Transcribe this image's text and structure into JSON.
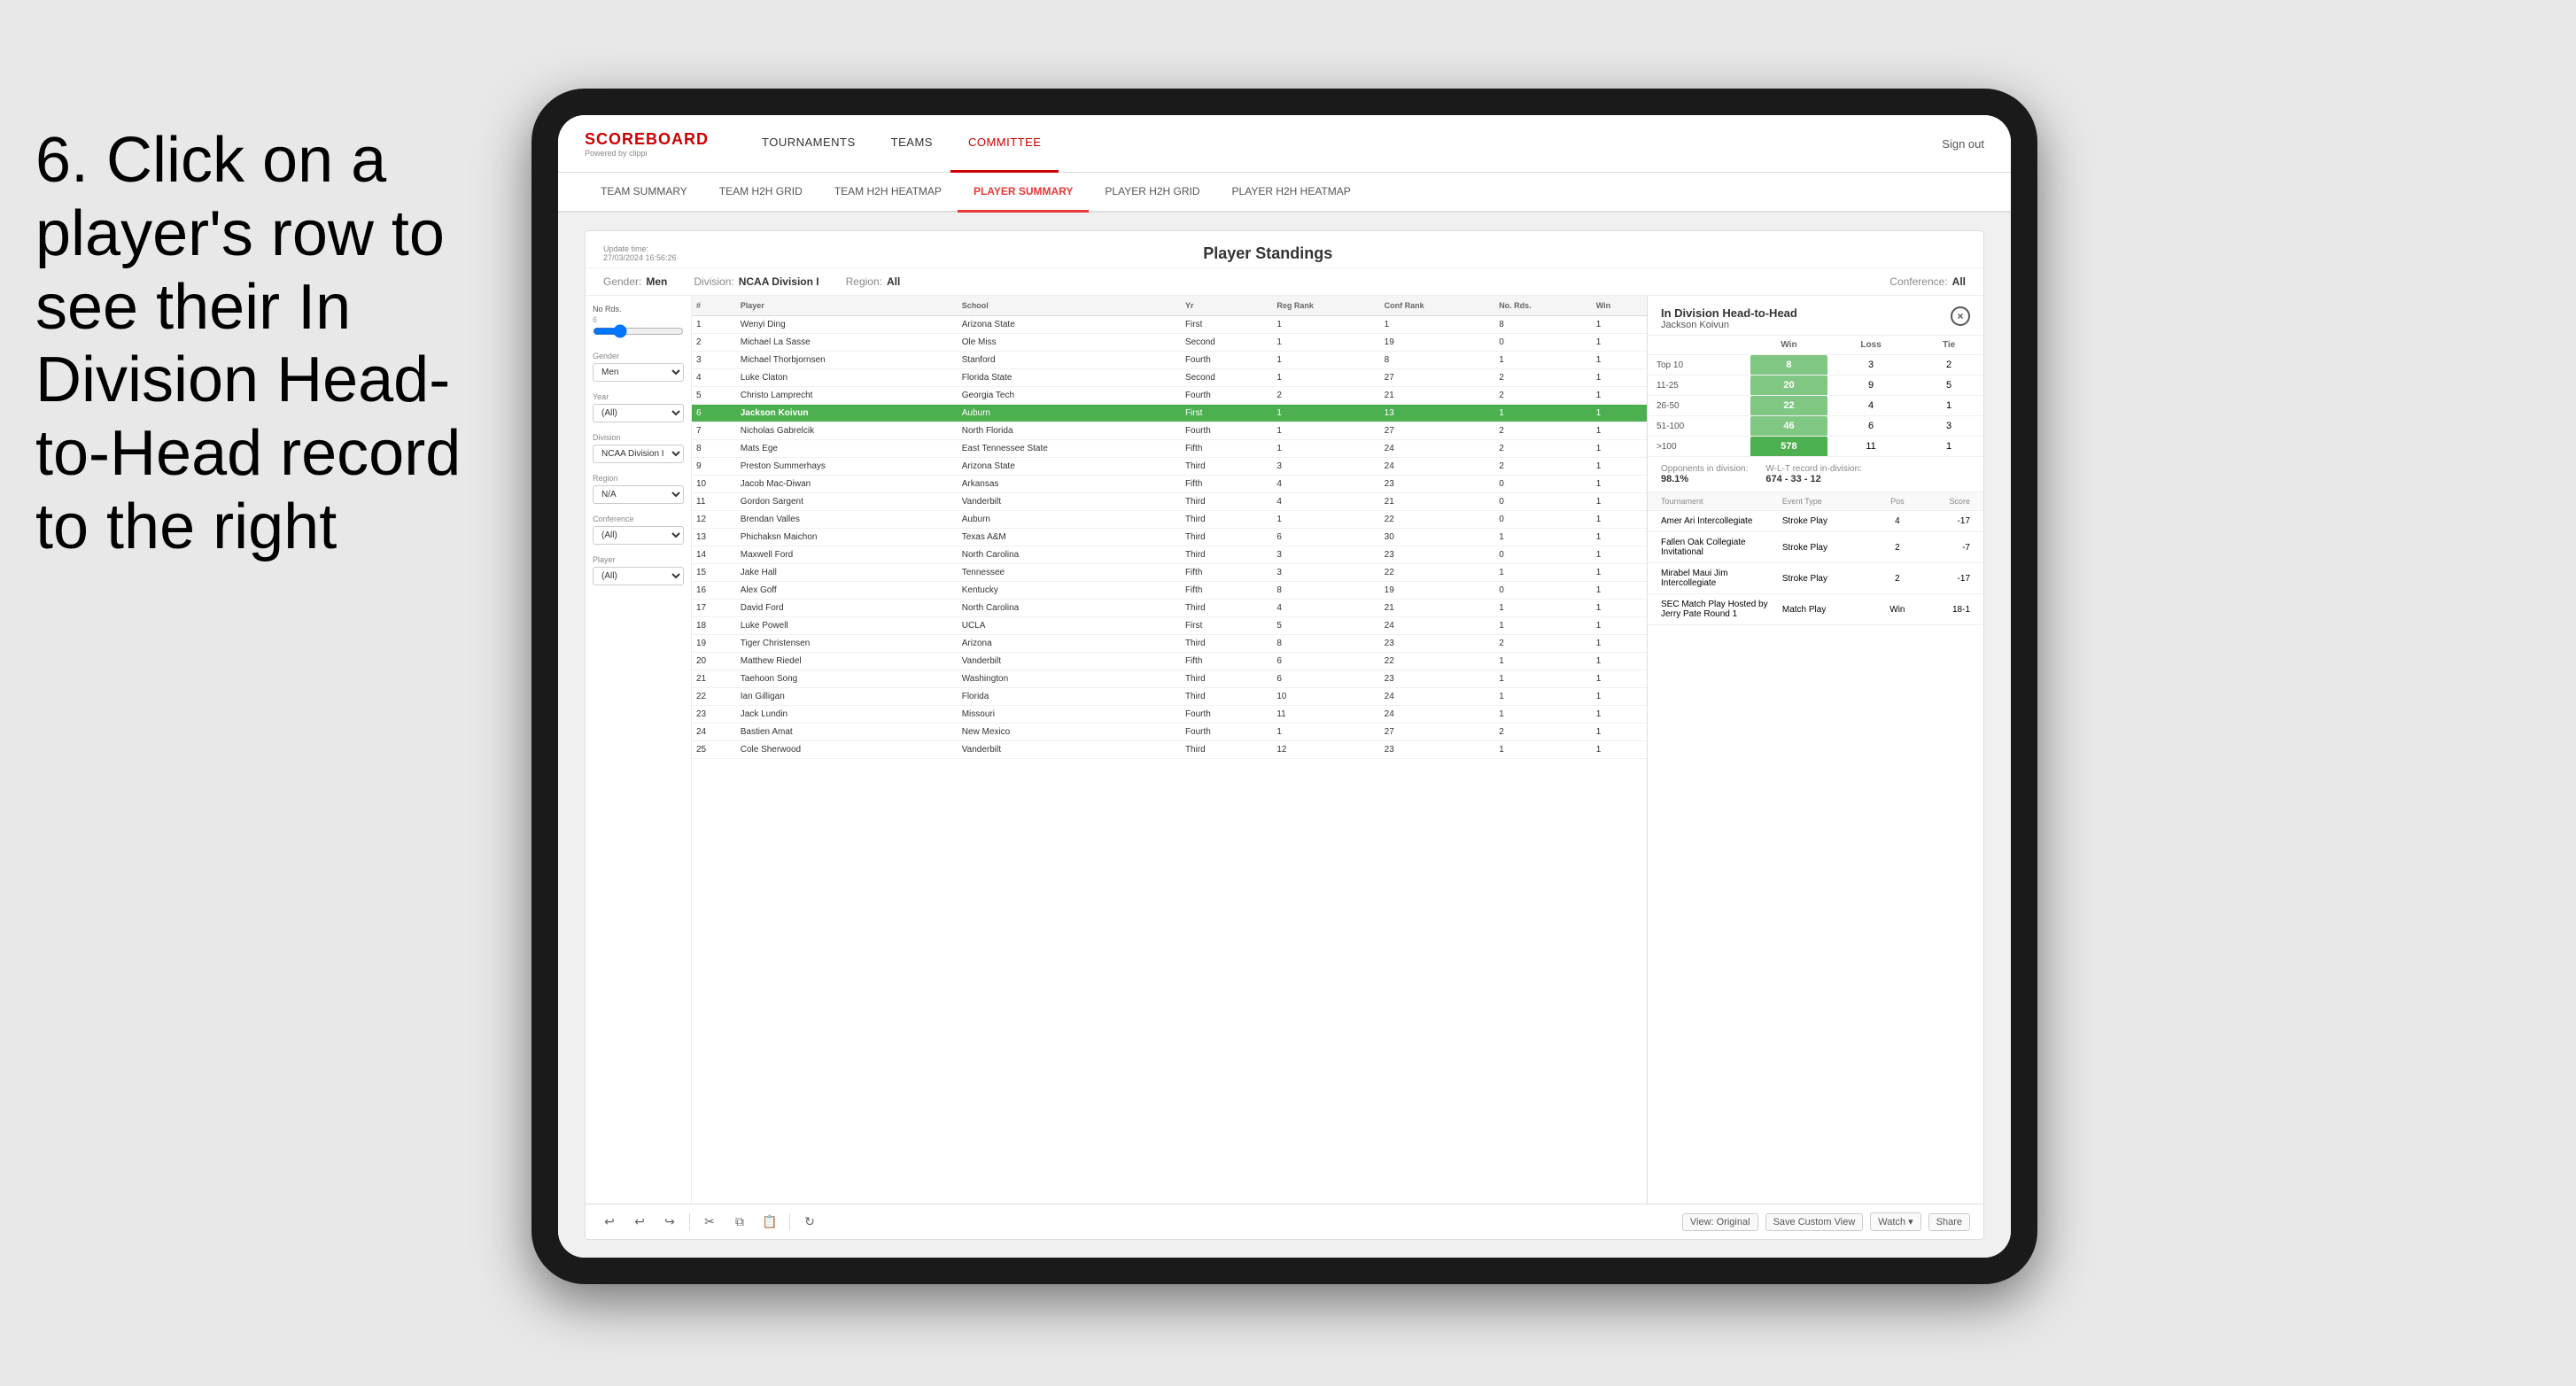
{
  "instruction": {
    "text": "6. Click on a player's row to see their In Division Head-to-Head record to the right"
  },
  "nav": {
    "logo": "SCOREBOARD",
    "logo_sub": "Powered by clippi",
    "items": [
      "TOURNAMENTS",
      "TEAMS",
      "COMMITTEE"
    ],
    "sign_out": "Sign out"
  },
  "sub_nav": {
    "items": [
      "TEAM SUMMARY",
      "TEAM H2H GRID",
      "TEAM H2H HEATMAP",
      "PLAYER SUMMARY",
      "PLAYER H2H GRID",
      "PLAYER H2H HEATMAP"
    ],
    "active": "PLAYER SUMMARY"
  },
  "card": {
    "update_time": "Update time:",
    "update_value": "27/03/2024 16:56:26",
    "title": "Player Standings",
    "filters": {
      "gender_label": "Gender:",
      "gender_value": "Men",
      "division_label": "Division:",
      "division_value": "NCAA Division I",
      "region_label": "Region:",
      "region_value": "All",
      "conference_label": "Conference:",
      "conference_value": "All"
    }
  },
  "sidebar": {
    "no_rds_label": "No Rds.",
    "gender_label": "Gender",
    "gender_value": "Men",
    "year_label": "Year",
    "year_value": "(All)",
    "division_label": "Division",
    "division_value": "NCAA Division I",
    "region_label": "Region",
    "region_value": "N/A",
    "conference_label": "Conference",
    "conference_value": "(All)",
    "player_label": "Player",
    "player_value": "(All)"
  },
  "table": {
    "headers": [
      "#",
      "Player",
      "School",
      "Yr",
      "Reg Rank",
      "Conf Rank",
      "No. Rds.",
      "Win"
    ],
    "rows": [
      {
        "rank": 1,
        "player": "Wenyi Ding",
        "school": "Arizona State",
        "yr": "First",
        "reg": 1,
        "conf": 1,
        "rds": 8,
        "win": 1,
        "selected": false
      },
      {
        "rank": 2,
        "player": "Michael La Sasse",
        "school": "Ole Miss",
        "yr": "Second",
        "reg": 1,
        "conf": 19,
        "rds": 0,
        "win": 1,
        "selected": false
      },
      {
        "rank": 3,
        "player": "Michael Thorbjornsen",
        "school": "Stanford",
        "yr": "Fourth",
        "reg": 1,
        "conf": 8,
        "rds": 1,
        "win": 1,
        "selected": false
      },
      {
        "rank": 4,
        "player": "Luke Claton",
        "school": "Florida State",
        "yr": "Second",
        "reg": 1,
        "conf": 27,
        "rds": 2,
        "win": 1,
        "selected": false
      },
      {
        "rank": 5,
        "player": "Christo Lamprecht",
        "school": "Georgia Tech",
        "yr": "Fourth",
        "reg": 2,
        "conf": 21,
        "rds": 2,
        "win": 1,
        "selected": false
      },
      {
        "rank": 6,
        "player": "Jackson Koivun",
        "school": "Auburn",
        "yr": "First",
        "reg": 1,
        "conf": 13,
        "rds": 1,
        "win": 1,
        "selected": true
      },
      {
        "rank": 7,
        "player": "Nicholas Gabrelcik",
        "school": "North Florida",
        "yr": "Fourth",
        "reg": 1,
        "conf": 27,
        "rds": 2,
        "win": 1,
        "selected": false
      },
      {
        "rank": 8,
        "player": "Mats Ege",
        "school": "East Tennessee State",
        "yr": "Fifth",
        "reg": 1,
        "conf": 24,
        "rds": 2,
        "win": 1,
        "selected": false
      },
      {
        "rank": 9,
        "player": "Preston Summerhays",
        "school": "Arizona State",
        "yr": "Third",
        "reg": 3,
        "conf": 24,
        "rds": 2,
        "win": 1,
        "selected": false
      },
      {
        "rank": 10,
        "player": "Jacob Mac-Diwan",
        "school": "Arkansas",
        "yr": "Fifth",
        "reg": 4,
        "conf": 23,
        "rds": 0,
        "win": 1,
        "selected": false
      },
      {
        "rank": 11,
        "player": "Gordon Sargent",
        "school": "Vanderbilt",
        "yr": "Third",
        "reg": 4,
        "conf": 21,
        "rds": 0,
        "win": 1,
        "selected": false
      },
      {
        "rank": 12,
        "player": "Brendan Valles",
        "school": "Auburn",
        "yr": "Third",
        "reg": 1,
        "conf": 22,
        "rds": 0,
        "win": 1,
        "selected": false
      },
      {
        "rank": 13,
        "player": "Phichaksn Maichon",
        "school": "Texas A&M",
        "yr": "Third",
        "reg": 6,
        "conf": 30,
        "rds": 1,
        "win": 1,
        "selected": false
      },
      {
        "rank": 14,
        "player": "Maxwell Ford",
        "school": "North Carolina",
        "yr": "Third",
        "reg": 3,
        "conf": 23,
        "rds": 0,
        "win": 1,
        "selected": false
      },
      {
        "rank": 15,
        "player": "Jake Hall",
        "school": "Tennessee",
        "yr": "Fifth",
        "reg": 3,
        "conf": 22,
        "rds": 1,
        "win": 1,
        "selected": false
      },
      {
        "rank": 16,
        "player": "Alex Goff",
        "school": "Kentucky",
        "yr": "Fifth",
        "reg": 8,
        "conf": 19,
        "rds": 0,
        "win": 1,
        "selected": false
      },
      {
        "rank": 17,
        "player": "David Ford",
        "school": "North Carolina",
        "yr": "Third",
        "reg": 4,
        "conf": 21,
        "rds": 1,
        "win": 1,
        "selected": false
      },
      {
        "rank": 18,
        "player": "Luke Powell",
        "school": "UCLA",
        "yr": "First",
        "reg": 5,
        "conf": 24,
        "rds": 1,
        "win": 1,
        "selected": false
      },
      {
        "rank": 19,
        "player": "Tiger Christensen",
        "school": "Arizona",
        "yr": "Third",
        "reg": 8,
        "conf": 23,
        "rds": 2,
        "win": 1,
        "selected": false
      },
      {
        "rank": 20,
        "player": "Matthew Riedel",
        "school": "Vanderbilt",
        "yr": "Fifth",
        "reg": 6,
        "conf": 22,
        "rds": 1,
        "win": 1,
        "selected": false
      },
      {
        "rank": 21,
        "player": "Taehoon Song",
        "school": "Washington",
        "yr": "Third",
        "reg": 6,
        "conf": 23,
        "rds": 1,
        "win": 1,
        "selected": false
      },
      {
        "rank": 22,
        "player": "Ian Gilligan",
        "school": "Florida",
        "yr": "Third",
        "reg": 10,
        "conf": 24,
        "rds": 1,
        "win": 1,
        "selected": false
      },
      {
        "rank": 23,
        "player": "Jack Lundin",
        "school": "Missouri",
        "yr": "Fourth",
        "reg": 11,
        "conf": 24,
        "rds": 1,
        "win": 1,
        "selected": false
      },
      {
        "rank": 24,
        "player": "Bastien Amat",
        "school": "New Mexico",
        "yr": "Fourth",
        "reg": 1,
        "conf": 27,
        "rds": 2,
        "win": 1,
        "selected": false
      },
      {
        "rank": 25,
        "player": "Cole Sherwood",
        "school": "Vanderbilt",
        "yr": "Third",
        "reg": 12,
        "conf": 23,
        "rds": 1,
        "win": 1,
        "selected": false
      }
    ]
  },
  "h2h_panel": {
    "title": "In Division Head-to-Head",
    "player": "Jackson Koivun",
    "close_btn": "×",
    "table_headers": [
      "",
      "Win",
      "Loss",
      "Tie"
    ],
    "rows": [
      {
        "label": "Top 10",
        "win": 8,
        "loss": 3,
        "tie": 2
      },
      {
        "label": "11-25",
        "win": 20,
        "loss": 9,
        "tie": 5
      },
      {
        "label": "26-50",
        "win": 22,
        "loss": 4,
        "tie": 1
      },
      {
        "label": "51-100",
        "win": 46,
        "loss": 6,
        "tie": 3
      },
      {
        "label": ">100",
        "win": 578,
        "loss": 11,
        "tie": 1
      }
    ],
    "opponents_label": "Opponents in division:",
    "wlt_label": "W-L-T record in-division:",
    "opponents_value": "98.1%",
    "wlt_value": "674 - 33 - 12",
    "tournament_headers": [
      "Tournament",
      "Event Type",
      "Pos",
      "Score"
    ],
    "tournaments": [
      {
        "name": "Amer Ari Intercollegiate",
        "type": "Stroke Play",
        "pos": 4,
        "score": "-17"
      },
      {
        "name": "Fallen Oak Collegiate Invitational",
        "type": "Stroke Play",
        "pos": 2,
        "score": "-7"
      },
      {
        "name": "Mirabel Maui Jim Intercollegiate",
        "type": "Stroke Play",
        "pos": 2,
        "score": "-17"
      },
      {
        "name": "SEC Match Play Hosted by Jerry Pate Round 1",
        "type": "Match Play",
        "pos": "Win",
        "score": "18-1"
      }
    ]
  },
  "toolbar": {
    "view_original": "View: Original",
    "save_custom": "Save Custom View",
    "watch": "Watch ▾",
    "share": "Share"
  }
}
